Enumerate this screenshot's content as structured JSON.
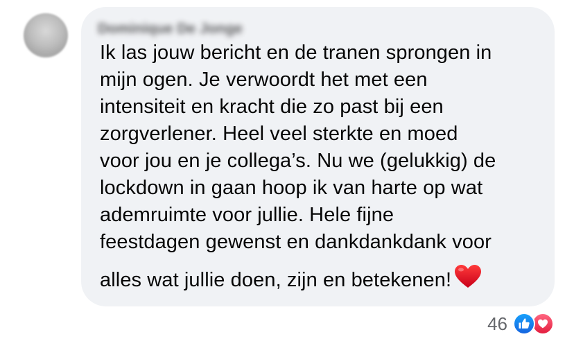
{
  "comment": {
    "author_name": "Dominique De Jonge",
    "lines": [
      "Ik las jouw bericht en de tranen sprongen in",
      "mijn ogen. Je verwoordt het met een",
      "intensiteit en kracht die zo past bij een",
      "zorgverlener. Heel veel sterkte en moed",
      "voor jou en je collega’s. Nu we (gelukkig) de",
      "lockdown in gaan hoop ik van harte op wat",
      "ademruimte voor jullie. Hele fijne",
      "feestdagen gewenst en dankdankdank voor",
      "alles wat jullie doen, zijn en betekenen!"
    ],
    "trailing_emoji": "heart-emoji"
  },
  "reactions": {
    "count": "46",
    "types": [
      "like-icon",
      "love-icon"
    ]
  },
  "colors": {
    "bubble_background": "#f0f2f5",
    "text": "#050505",
    "secondary_text": "#65676b",
    "like_blue": "#1877f2",
    "love_red": "#f33e58"
  }
}
